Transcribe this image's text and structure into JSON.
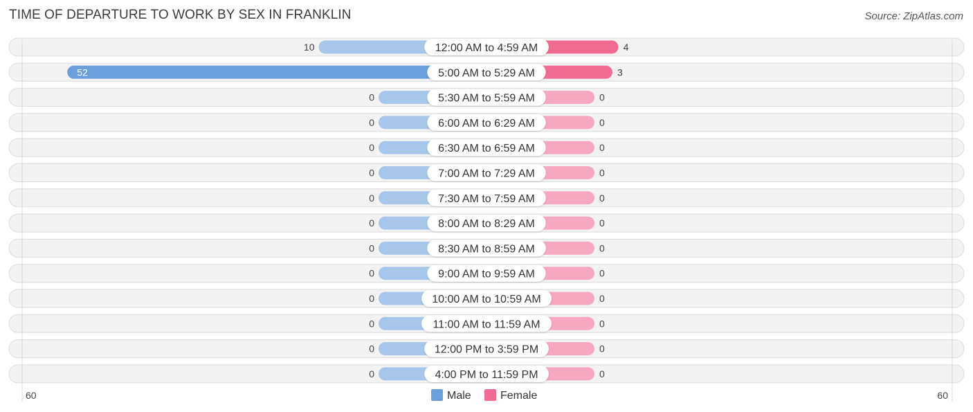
{
  "header": {
    "title": "TIME OF DEPARTURE TO WORK BY SEX IN FRANKLIN",
    "source": "Source: ZipAtlas.com"
  },
  "colors": {
    "male_strong": "#6a9fdb",
    "male_light": "#a8c6ea",
    "female_strong": "#f06a92",
    "female_light": "#f6a8c0"
  },
  "chart_data": {
    "type": "bar",
    "orientation": "horizontal-diverging",
    "title": "TIME OF DEPARTURE TO WORK BY SEX IN FRANKLIN",
    "categories": [
      "12:00 AM to 4:59 AM",
      "5:00 AM to 5:29 AM",
      "5:30 AM to 5:59 AM",
      "6:00 AM to 6:29 AM",
      "6:30 AM to 6:59 AM",
      "7:00 AM to 7:29 AM",
      "7:30 AM to 7:59 AM",
      "8:00 AM to 8:29 AM",
      "8:30 AM to 8:59 AM",
      "9:00 AM to 9:59 AM",
      "10:00 AM to 10:59 AM",
      "11:00 AM to 11:59 AM",
      "12:00 PM to 3:59 PM",
      "4:00 PM to 11:59 PM"
    ],
    "series": [
      {
        "name": "Male",
        "values": [
          10,
          52,
          0,
          0,
          0,
          0,
          0,
          0,
          0,
          0,
          0,
          0,
          0,
          0
        ]
      },
      {
        "name": "Female",
        "values": [
          4,
          3,
          0,
          0,
          0,
          0,
          0,
          0,
          0,
          0,
          0,
          0,
          0,
          0
        ]
      }
    ],
    "axis": {
      "left_tick": "60",
      "right_tick": "60",
      "max": 60
    },
    "legend": {
      "position": "bottom-center",
      "items": [
        "Male",
        "Female"
      ]
    },
    "xlabel": "",
    "ylabel": ""
  }
}
